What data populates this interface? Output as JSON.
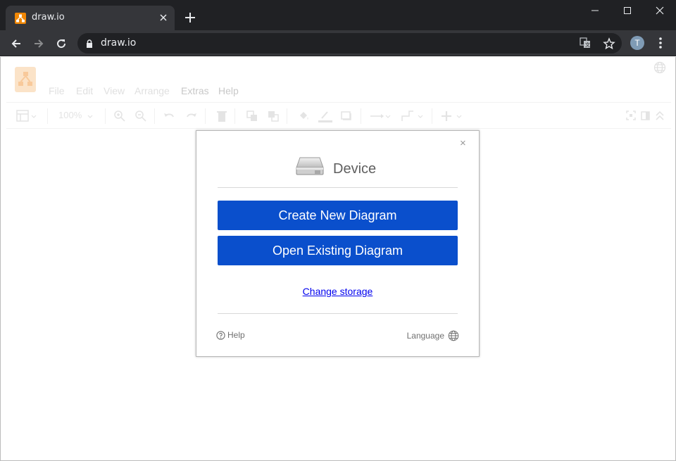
{
  "browser": {
    "tab_title": "draw.io",
    "url": "draw.io",
    "avatar_initial": "T"
  },
  "app": {
    "menu": [
      "File",
      "Edit",
      "View",
      "Arrange",
      "Extras",
      "Help"
    ],
    "zoom": "100%"
  },
  "dialog": {
    "title": "Device",
    "create_label": "Create New Diagram",
    "open_label": "Open Existing Diagram",
    "change_storage_label": "Change storage",
    "help_label": "Help",
    "language_label": "Language",
    "close_symbol": "×"
  },
  "colors": {
    "primary_button": "#0a4fcc",
    "browser_frame": "#202124",
    "logo_orange": "#f08705"
  }
}
